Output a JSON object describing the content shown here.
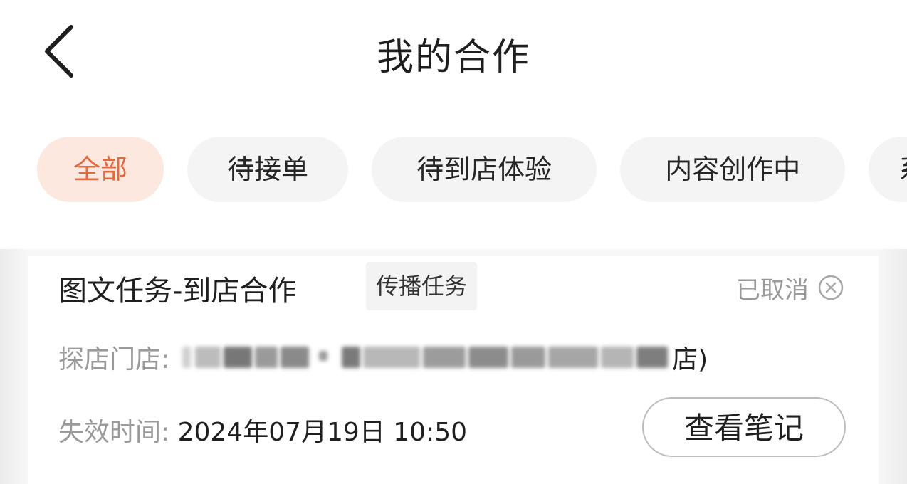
{
  "header": {
    "title": "我的合作",
    "back_icon": "chevron-left-icon"
  },
  "tabs": [
    {
      "label": "全部",
      "active": true
    },
    {
      "label": "待接单",
      "active": false
    },
    {
      "label": "待到店体验",
      "active": false
    },
    {
      "label": "内容创作中",
      "active": false
    },
    {
      "label": "系",
      "active": false
    }
  ],
  "card": {
    "title": "图文任务-到店合作",
    "tag": "传播任务",
    "status": "已取消",
    "status_icon": "close-circle-icon",
    "store_label": "探店门店:",
    "store_value_visible_tail": "店)",
    "expiry_label": "失效时间:",
    "expiry_value": "2024年07月19日 10:50",
    "action_label": "查看笔记"
  },
  "colors": {
    "accent": "#e46a3e",
    "accent_bg": "#fde8e0",
    "tab_bg": "#f4f4f4",
    "muted_text": "#9a9a9a"
  }
}
